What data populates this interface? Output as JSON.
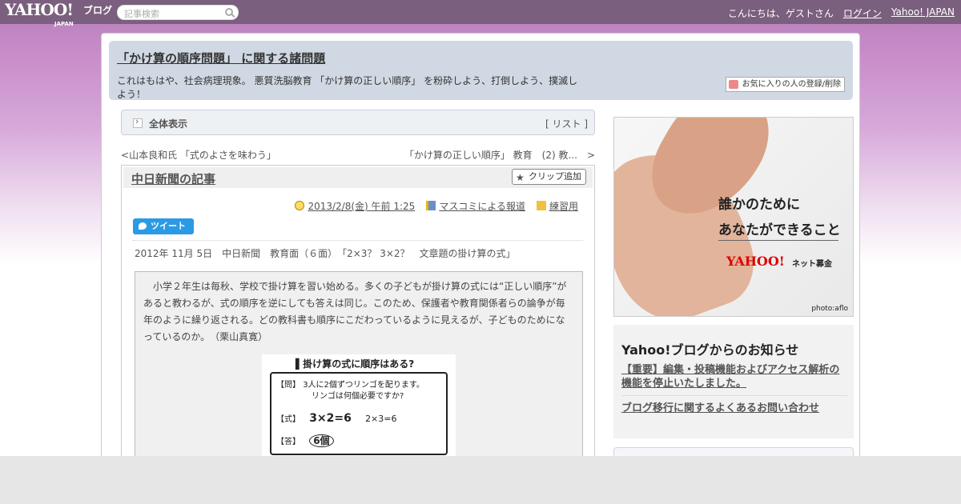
{
  "topbar": {
    "logo": "YAHOO!",
    "logo_sub": "JAPAN",
    "logo_blog": "ブログ",
    "search_placeholder": "記事検索",
    "greeting": "こんにちは、ゲストさん",
    "login": "ログイン",
    "yahoo_japan": "Yahoo! JAPAN"
  },
  "blog": {
    "title": "「かけ算の順序問題」 に関する諸問題",
    "description": "これはもはや、社会病理現象。 悪質洗脳教育 「かけ算の正しい順序」 を粉砕しよう、打倒しよう、撲滅しよう！",
    "fav_button": "お気に入りの人の登録/削除"
  },
  "allview": {
    "label": "全体表示",
    "list_open": "[",
    "list_link": "リスト",
    "list_close": "]"
  },
  "nav": {
    "prev_marker": "<",
    "prev": "山本良和氏 「式のよさを味わう」",
    "next": "「かけ算の正しい順序」 教育　(2) 教...",
    "next_marker": ">"
  },
  "article": {
    "title": "中日新聞の記事",
    "clip_button": "クリップ追加",
    "date": "2013/2/8(金) 午前 1:25",
    "category": "マスコミによる報道",
    "folder": "練習用",
    "tweet": "ツイート",
    "subtitle": "2012年 11月 5日　中日新聞　教育面（６面）　「2×3？ 3×2？　文章題の掛け算の式」",
    "body": "　小学２年生は毎秋、学校で掛け算を習い始める。多くの子どもが掛け算の式には“正しい順序”があると教わるが、式の順序を逆にしても答えは同じ。このため、保護者や教育関係者らの論争が毎年のように繰り返される。どの教科書も順序にこだわっているように見えるが、子どものためになっているのか。　（栗山真寛）",
    "figure": {
      "title": "▌掛け算の式に順序はある?",
      "q_label": "【問】",
      "q_text": "3人に2個ずつリンゴを配ります。",
      "q_text2": "リンゴは何個必要ですか?",
      "f_label": "【式】",
      "f_text": "3×2=6",
      "f_text2": "2×3=6",
      "a_label": "【答】",
      "a_text": "6個"
    }
  },
  "ad": {
    "line1": "誰かのために",
    "line2": "あなたができること",
    "brand": "YAHOO!",
    "brand_sub": "ネット募金",
    "photo": "photo:aflo"
  },
  "notice": {
    "title": "Yahoo!ブログからのお知らせ",
    "items": [
      "【重要】編集・投稿機能およびアクセス解析の機能を停止いたしました。",
      "ブログ移行に関するよくあるお問い合わせ"
    ]
  }
}
